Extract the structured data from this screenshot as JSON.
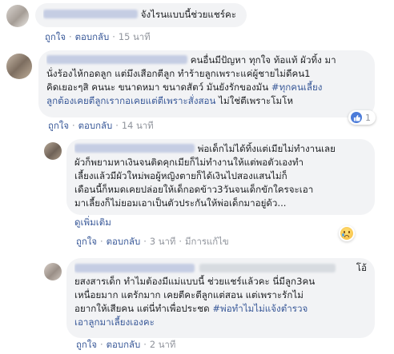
{
  "comments": [
    {
      "text_parts": [
        "จังไรนแบบนี้ช่วยแชร์คะ"
      ],
      "like": "ถูกใจ",
      "reply": "ตอบกลับ",
      "time": "15 นาที"
    },
    {
      "lines": [
        "คนอื่นมีปัญหา ทุกใจ ท้อแท้ ผัวทิ้ง มา",
        "นั่งร้องไห้กอดลูก แต่มึงเสือกตีลูก ทำร้ายลูกเพราะแค่ผู้ชายไม่ดีคน1",
        "คิดเยอะๆสิ คนนะ ขนาดหมา ขนาดสัตว์ มันยังรักของมัน",
        "ลูกต้องเคยตีลูกเรากอเคยแต่ตีเพราะสั่งสอน"
      ],
      "hashtag": "#ทุกคนเลี้ยง",
      "tail": "ไม่ใช่ตีเพราะโมโห",
      "reaction_count": "1",
      "like": "ถูกใจ",
      "reply": "ตอบกลับ",
      "time": "14 นาที"
    },
    {
      "lines": [
        "พ่อเด็กไม่ได้ทิ้งแต่เมียไม่ทำงานเลย",
        "ผัวก็พยามหาเงินจนติดคุกเมียก็ไม่ทำงานให้แต่พอตัวเองทำ",
        "เลี้ยงแล้วมีผัวใหม่พอผู้หญิงตายก็ได้เงินไปสองแสนไม่ก็",
        "เดือนนี้ก็หมดเคยปล่อยให้เด็กอดข้าว3วันจนเด็กขักใครจะเอา",
        "มาเลี้ยงก็ไม่ยอมเอาเป็นตัวประกันให้พ่อเด็กมาอยู่ด้ว..."
      ],
      "see_more": "ดูเพิ่มเติม",
      "like": "ถูกใจ",
      "reply": "ตอบกลับ",
      "time": "3 นาที",
      "edited": "มีการแก้ไข"
    },
    {
      "lines": [
        "โอ้",
        "ยสงสารเด็ก ทำไมต้องมีแม่แบบนี้ ช่วยแชร์แล้วคะ นี่มีลูก3คน",
        "เหนื่อยมาก แตรักมาก เคยตีคะตีลูกแต่สอน แต่เพราะรักไม่",
        "อยากให้เสียคน แต่นี่ทำเพื่อประชด",
        "เอาลูกมาเลี้ยงเองคะ"
      ],
      "hashtag": "#พ่อทำไมไม่แจ้งตำรวจ",
      "like": "ถูกใจ",
      "reply": "ตอบกลับ",
      "time": "2 นาที"
    }
  ],
  "colors": {
    "link": "#385898",
    "bubble": "#f2f3f5",
    "meta": "#90949c",
    "like_blue": "#4b7bd9"
  },
  "icons": {
    "reaction_like": "like-icon",
    "reaction_sad": "sad-icon"
  }
}
